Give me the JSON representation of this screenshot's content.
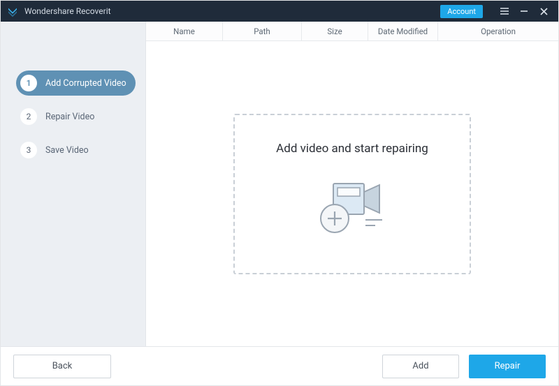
{
  "titlebar": {
    "app_name": "Wondershare Recoverit",
    "account_label": "Account"
  },
  "sidebar": {
    "steps": [
      {
        "num": "1",
        "label": "Add Corrupted Video"
      },
      {
        "num": "2",
        "label": "Repair Video"
      },
      {
        "num": "3",
        "label": "Save Video"
      }
    ],
    "active_index": 0
  },
  "columns": {
    "name": "Name",
    "path": "Path",
    "size": "Size",
    "date": "Date Modified",
    "operation": "Operation"
  },
  "dropzone": {
    "title": "Add video and start repairing"
  },
  "footer": {
    "back": "Back",
    "add": "Add",
    "repair": "Repair"
  }
}
